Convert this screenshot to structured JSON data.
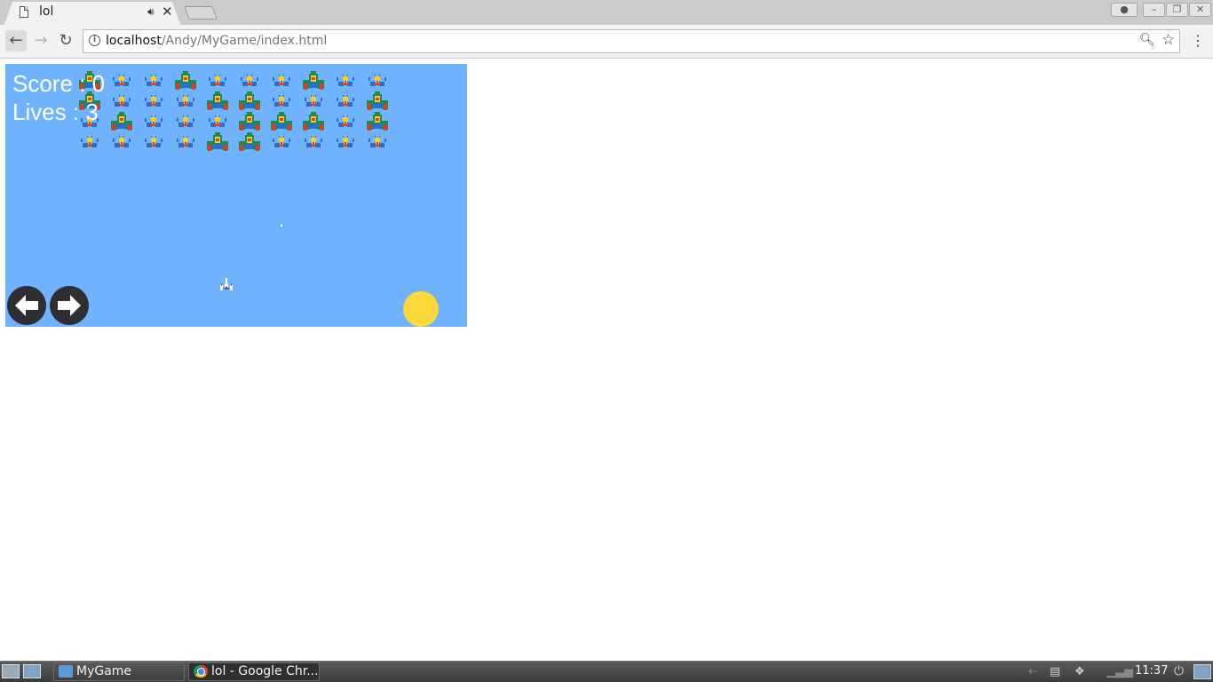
{
  "browser": {
    "tab": {
      "title": "lol"
    },
    "url": {
      "host": "localhost",
      "path": "/Andy/MyGame/index.html"
    }
  },
  "game": {
    "score_text": "Score : 0",
    "lives_text": "Lives : 3",
    "aliens": {
      "columns": 10,
      "rows": [
        [
          "boss",
          "bug",
          "bug",
          "boss",
          "bug",
          "bug",
          "bug",
          "boss",
          "bug",
          "bug"
        ],
        [
          "boss",
          "bug",
          "bug",
          "bug",
          "boss",
          "boss",
          "bug",
          "bug",
          "bug",
          "boss"
        ],
        [
          "bug",
          "boss",
          "bug",
          "bug",
          "bug",
          "boss",
          "boss",
          "boss",
          "bug",
          "boss"
        ],
        [
          "bug",
          "bug",
          "bug",
          "bug",
          "boss",
          "boss",
          "bug",
          "bug",
          "bug",
          "bug"
        ]
      ]
    },
    "colors": {
      "sky": "#6fb3ff",
      "hud_text": "#ffffff",
      "fire_button": "#fcd83a",
      "arrow_button": "#2f2f33"
    }
  },
  "taskbar": {
    "tasks": [
      {
        "label": "MyGame",
        "icon": "folder-icon"
      },
      {
        "label": "lol - Google Chr...",
        "icon": "chrome-icon"
      }
    ],
    "clock": "11:37"
  }
}
